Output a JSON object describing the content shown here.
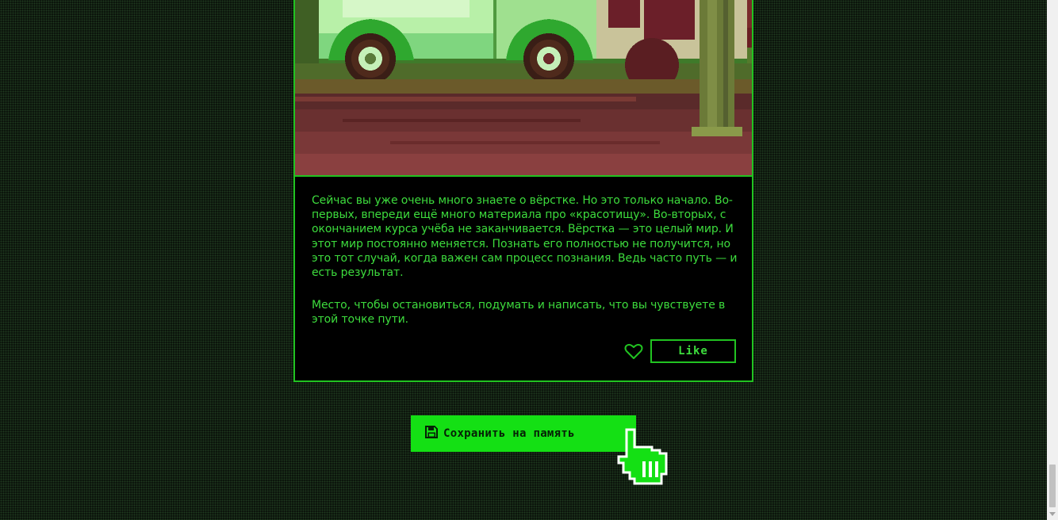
{
  "card": {
    "image_alt": "pixel art of a green van parked on a road next to a tree",
    "paragraph1": "Сейчас вы уже очень много знаете о вёрстке. Но это только начало. Во-первых, впереди ещё много материала про «красотищу». Во-вторых, с окончанием курса учёба не заканчивается. Вёрстка — это целый мир. И этот мир постоянно меняется. Познать его полностью не получится, но это тот случай, когда важен сам процесс познания. Ведь часто путь — и есть результат.",
    "paragraph2": "Место, чтобы остановиться, подумать и написать, что вы чувствуете в этой точке пути.",
    "like_label": "Like",
    "heart_icon": "heart-outline-icon"
  },
  "save_button": {
    "label": "Сохранить на память",
    "icon": "floppy-disk-icon"
  },
  "cursor": {
    "icon": "pointing-hand-cursor-icon"
  },
  "colors": {
    "accent": "#14e014",
    "text": "#3ddc3d",
    "border": "#21c321",
    "background": "#0b130b"
  }
}
